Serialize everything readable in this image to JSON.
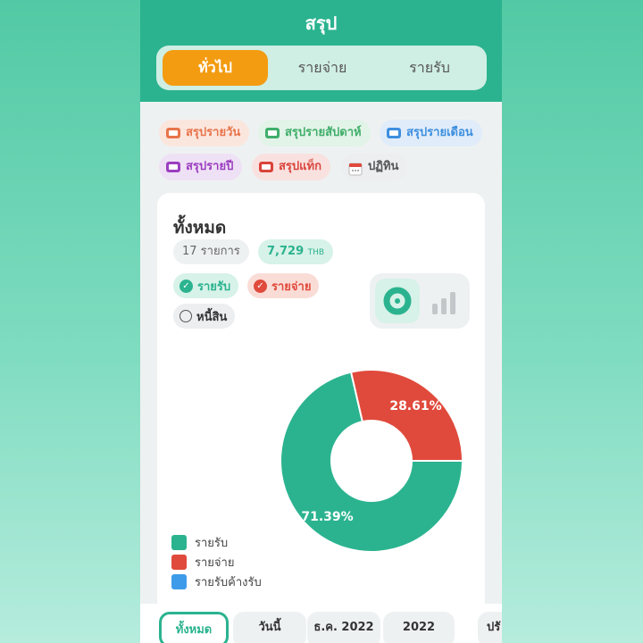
{
  "header": {
    "title": "สรุป"
  },
  "tabs": [
    {
      "label": "ทั่วไป",
      "active": true
    },
    {
      "label": "รายจ่าย",
      "active": false
    },
    {
      "label": "รายรับ",
      "active": false
    }
  ],
  "chips": [
    {
      "label": "สรุปรายวัน",
      "icon": "card-icon",
      "color": "#e8744a",
      "bg": "#fbe6de"
    },
    {
      "label": "สรุปรายสัปดาห์",
      "icon": "card-icon",
      "color": "#3fae6a",
      "bg": "#e2f3e7"
    },
    {
      "label": "สรุปรายเดือน",
      "icon": "card-icon",
      "color": "#3d8fe0",
      "bg": "#e0ecf9"
    },
    {
      "label": "สรุปรายปี",
      "icon": "card-icon",
      "color": "#9b3fc0",
      "bg": "#efe1f5"
    },
    {
      "label": "สรุปแท็ก",
      "icon": "card-icon",
      "color": "#d9443a",
      "bg": "#f9e1df"
    },
    {
      "label": "ปฏิทิน",
      "icon": "calendar-icon",
      "color": "#555555",
      "bg": "#eceef0"
    }
  ],
  "summary": {
    "title": "ทั้งหมด",
    "count_label": "17 รายการ",
    "amount": "7,729",
    "currency": "THB"
  },
  "filters": [
    {
      "label": "รายรับ",
      "checked": true,
      "color": "#2bb38f",
      "bg": "#d7f2e8"
    },
    {
      "label": "รายจ่าย",
      "checked": true,
      "color": "#e04a3c",
      "bg": "#fadcd7"
    },
    {
      "label": "หนี้สิน",
      "checked": false,
      "color": "#333333",
      "bg": "#eceef0"
    }
  ],
  "chart_view_toggle": {
    "options": [
      "donut-chart-icon",
      "bar-chart-icon"
    ],
    "selected": "donut-chart-icon"
  },
  "chart_data": {
    "type": "pie",
    "slices": [
      {
        "label": "รายรับ",
        "value": 71.39,
        "display": "71.39%",
        "color": "#2bb38f"
      },
      {
        "label": "รายจ่าย",
        "value": 28.61,
        "display": "28.61%",
        "color": "#e04a3c"
      }
    ],
    "legend": [
      {
        "label": "รายรับ",
        "color": "#2bb38f"
      },
      {
        "label": "รายจ่าย",
        "color": "#e04a3c"
      },
      {
        "label": "รายรับค้างรับ",
        "color": "#3d9be9"
      }
    ],
    "legend_position": "bottom-left"
  },
  "bottom_tabs": [
    {
      "label": "ทั้งหมด",
      "active": true
    },
    {
      "label": "วันนี้",
      "active": false
    },
    {
      "label": "ธ.ค. 2022",
      "active": false
    },
    {
      "label": "2022",
      "active": false
    },
    {
      "label": "ปรั",
      "active": false
    }
  ]
}
